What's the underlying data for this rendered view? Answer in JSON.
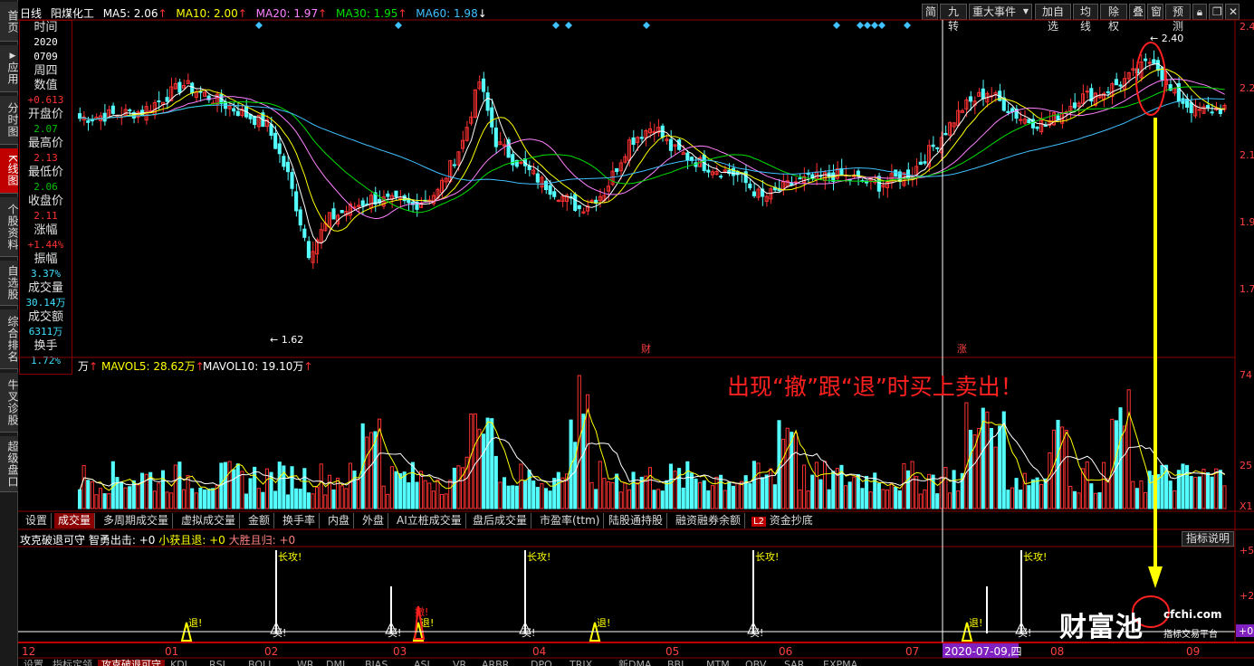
{
  "vtabs": [
    {
      "label": "首页"
    },
    {
      "label": "应用"
    },
    {
      "label": "分时图"
    },
    {
      "label": "K线图"
    },
    {
      "label": "个股资料"
    },
    {
      "label": "自选股"
    },
    {
      "label": "综合排名"
    },
    {
      "label": "牛叉诊股"
    },
    {
      "label": "超级盘口"
    }
  ],
  "header": {
    "period": "日线",
    "stock": "阳煤化工",
    "ma5": "MA5: 2.06",
    "ma10": "MA10: 2.00",
    "ma20": "MA20: 1.97",
    "ma30": "MA30: 1.95",
    "ma60": "MA60: 1.98"
  },
  "toolbar": [
    "简",
    "九转",
    "重大事件",
    "加自选",
    "均线",
    "除权",
    "叠",
    "窗",
    "预测"
  ],
  "info": {
    "time_label": "时间",
    "date1": "2020",
    "date2": "0709",
    "weekday": "周四",
    "value_label": "数值",
    "value": "+0.613",
    "open_label": "开盘价",
    "open": "2.07",
    "high_label": "最高价",
    "high": "2.13",
    "low_label": "最低价",
    "low": "2.06",
    "close_label": "收盘价",
    "close": "2.11",
    "chg_label": "涨幅",
    "chg": "+1.44%",
    "amp_label": "振幅",
    "amp": "3.37%",
    "vol_label": "成交量",
    "vol": "30.14万",
    "amt_label": "成交额",
    "amt": "6311万",
    "turn_label": "换手",
    "turn": "1.72%"
  },
  "price_axis": [
    "2.4",
    "2.2",
    "2.1",
    "1.9",
    "1.7"
  ],
  "annotations": {
    "high": "2.40",
    "low": "1.62",
    "cai": "财",
    "zhang": "涨"
  },
  "vol_header": {
    "vol": "万",
    "mavol5": "MAVOL5: 28.62万",
    "mavol10": "MAVOL10: 19.10万"
  },
  "vol_axis": [
    "74",
    "25",
    "X1"
  ],
  "callout": "出现“撤”跟“退”时买上卖出！",
  "tabs": [
    "设置",
    "成交量",
    "多周期成交量",
    "虚拟成交量",
    "金额",
    "换手率",
    "内盘",
    "外盘",
    "AI立桩成交量",
    "盘后成交量",
    "市盈率(ttm)",
    "陆股通持股",
    "融资融券余额",
    "资金抄底"
  ],
  "tab_badge": "L2",
  "indicator": {
    "name": "攻克破退可守",
    "s1": "智勇出击: +0",
    "s2": "小获且退: +0",
    "s3": "大胜且归: +0",
    "explain": "指标说明"
  },
  "ind_axis": [
    "+5",
    "+2",
    "+0"
  ],
  "ind_labels": {
    "gong": "长攻!",
    "tui": "退!",
    "mai": "买!",
    "che": "撤!"
  },
  "dates": [
    "12",
    "01",
    "02",
    "03",
    "04",
    "05",
    "06",
    "07",
    "08",
    "09"
  ],
  "cursor_date": "2020-07-09,四",
  "bottom_tabs": [
    "设置",
    "指标定领",
    "攻克破退可守",
    "KDJ",
    "RSI",
    "BOLL",
    "WR",
    "DMI",
    "BIAS",
    "ASI",
    "VR",
    "ARBR",
    "DPO",
    "TRIX",
    "新DMA",
    "BBI",
    "MTM",
    "OBV",
    "SAR",
    "EXPMA"
  ],
  "watermark": {
    "brand": "财富池",
    "url": "cfchi.com",
    "sub": "指标交易平台"
  },
  "colors": {
    "up": "#ff3232",
    "down": "#54ffff",
    "ma5": "#ffffff",
    "ma10": "#ffff00",
    "ma20": "#ff80ff",
    "ma30": "#00e000",
    "ma60": "#40c0ff",
    "accent": "#ffff00"
  }
}
